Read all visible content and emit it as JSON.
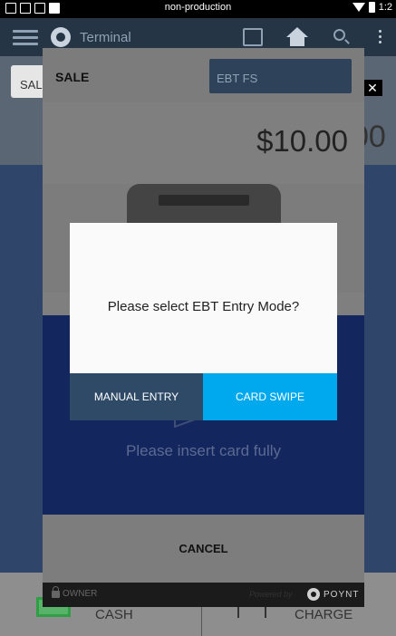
{
  "status_bar": {
    "center_text": "non-production",
    "clock": "1:2"
  },
  "app_bar": {
    "title": "Terminal"
  },
  "background": {
    "sale_tab": "SAL",
    "amount_tail": "00",
    "cash_label": "CASH",
    "charge_label": "CHARGE"
  },
  "sale_panel": {
    "title": "SALE",
    "ebt_tab": "EBT FS",
    "amount": "$10.00",
    "insert_prompt": "Please insert card fully",
    "cancel_label": "CANCEL",
    "owner_label": "OWNER",
    "powered_by": "Powered by",
    "brand": "POYNT"
  },
  "dialog": {
    "message": "Please select EBT Entry Mode?",
    "manual_label": "MANUAL ENTRY",
    "swipe_label": "CARD SWIPE"
  },
  "colors": {
    "accent": "#00a9ee",
    "manual_button": "#2f4a67",
    "app_bar": "#253546"
  }
}
